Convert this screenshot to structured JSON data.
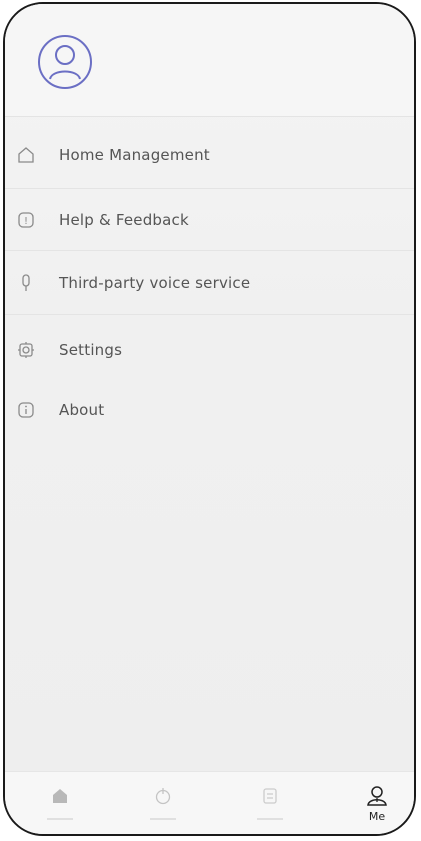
{
  "menu": {
    "items": [
      {
        "icon": "home-icon",
        "label": "Home Management"
      },
      {
        "icon": "help-icon",
        "label": "Help & Feedback"
      },
      {
        "icon": "microphone-icon",
        "label": "Third-party voice service"
      },
      {
        "icon": "gear-icon",
        "label": "Settings"
      },
      {
        "icon": "info-icon",
        "label": "About"
      }
    ]
  },
  "profile": {
    "avatar_icon": "user-avatar-icon"
  },
  "tabbar": {
    "tabs": [
      {
        "icon": "home-tab-icon",
        "label": ""
      },
      {
        "icon": "timer-tab-icon",
        "label": ""
      },
      {
        "icon": "scene-tab-icon",
        "label": ""
      },
      {
        "icon": "me-tab-icon",
        "label": "Me",
        "active": true
      }
    ]
  },
  "colors": {
    "accent": "#6b6fc4",
    "text": "#555555",
    "frame": "#1a1a1a"
  }
}
